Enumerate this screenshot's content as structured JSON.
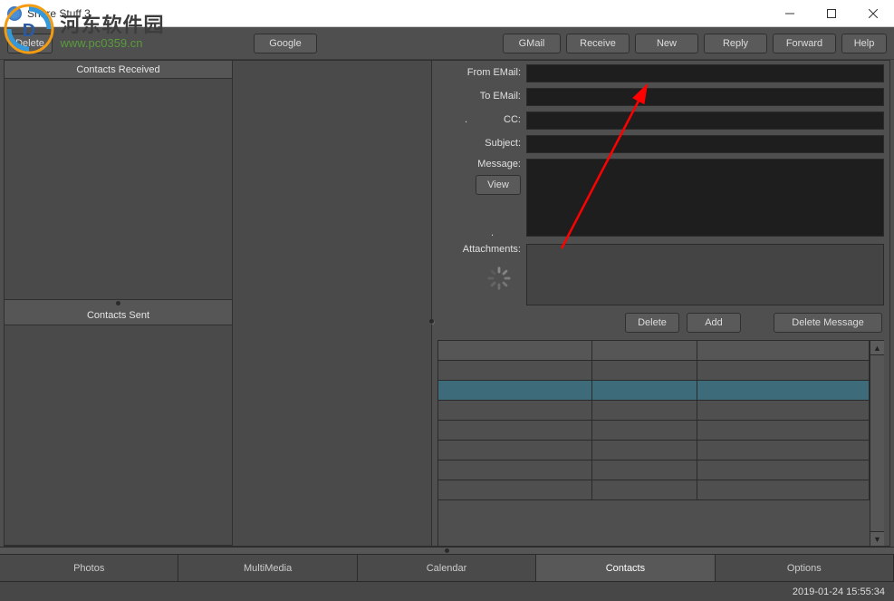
{
  "window": {
    "title": "Share Stuff 3"
  },
  "watermark": {
    "cn": "河东软件园",
    "url": "www.pc0359.cn"
  },
  "toolbar": {
    "delete": "Delete",
    "google": "Google",
    "gmail": "GMail",
    "receive": "Receive",
    "new": "New",
    "reply": "Reply",
    "forward": "Forward",
    "help": "Help"
  },
  "left": {
    "received_header": "Contacts Received",
    "sent_header": "Contacts Sent"
  },
  "form": {
    "from_label": "From EMail:",
    "to_label": "To EMail:",
    "cc_label": "CC:",
    "cc_dot": ".",
    "subject_label": "Subject:",
    "message_label": "Message:",
    "view_btn": "View",
    "msg_dot": ".",
    "attachments_label": "Attachments:",
    "from_value": "",
    "to_value": "",
    "cc_value": "",
    "subject_value": "",
    "message_value": ""
  },
  "actions": {
    "delete": "Delete",
    "add": "Add",
    "delete_message": "Delete Message"
  },
  "tabs": {
    "photos": "Photos",
    "multimedia": "MultiMedia",
    "calendar": "Calendar",
    "contacts": "Contacts",
    "options": "Options"
  },
  "status": {
    "datetime": "2019-01-24 15:55:34"
  }
}
